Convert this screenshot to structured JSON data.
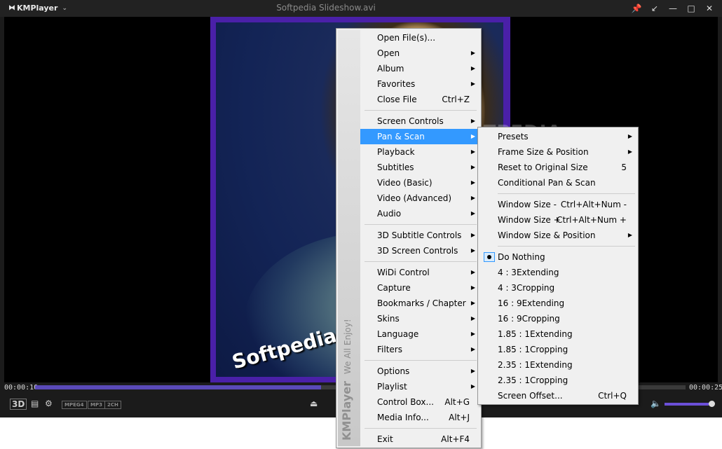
{
  "window": {
    "app_name": "KMPlayer",
    "title": "Softpedia Slideshow.avi",
    "buttons": [
      "pin",
      "back",
      "minimize",
      "maximize",
      "close"
    ]
  },
  "video": {
    "overlay_text": "Softpedia test",
    "watermark": "SOFTPEDIA"
  },
  "seek": {
    "current_time": "00:00:10",
    "total_time": "00:00:25",
    "progress": 0.44
  },
  "controls": {
    "badges": [
      "MPEG4",
      "MP3",
      "2CH"
    ],
    "volume": 0.9
  },
  "menu": {
    "brand": "KMPlayer",
    "tagline": "We All Enjoy!",
    "items": [
      {
        "label": "Open File(s)...",
        "shortcut": "",
        "sub": false
      },
      {
        "label": "Open",
        "shortcut": "",
        "sub": true
      },
      {
        "label": "Album",
        "shortcut": "",
        "sub": true
      },
      {
        "label": "Favorites",
        "shortcut": "",
        "sub": true
      },
      {
        "label": "Close File",
        "shortcut": "Ctrl+Z",
        "sub": false
      },
      {
        "label": "Screen Controls",
        "shortcut": "",
        "sub": true
      },
      {
        "label": "Pan & Scan",
        "shortcut": "",
        "sub": true
      },
      {
        "label": "Playback",
        "shortcut": "",
        "sub": true
      },
      {
        "label": "Subtitles",
        "shortcut": "",
        "sub": true
      },
      {
        "label": "Video (Basic)",
        "shortcut": "",
        "sub": true
      },
      {
        "label": "Video (Advanced)",
        "shortcut": "",
        "sub": true
      },
      {
        "label": "Audio",
        "shortcut": "",
        "sub": true
      },
      {
        "label": "3D Subtitle Controls",
        "shortcut": "",
        "sub": true
      },
      {
        "label": "3D Screen Controls",
        "shortcut": "",
        "sub": true
      },
      {
        "label": "WiDi Control",
        "shortcut": "",
        "sub": true
      },
      {
        "label": "Capture",
        "shortcut": "",
        "sub": true
      },
      {
        "label": "Bookmarks / Chapter",
        "shortcut": "",
        "sub": true
      },
      {
        "label": "Skins",
        "shortcut": "",
        "sub": true
      },
      {
        "label": "Language",
        "shortcut": "",
        "sub": true
      },
      {
        "label": "Filters",
        "shortcut": "",
        "sub": true
      },
      {
        "label": "Options",
        "shortcut": "",
        "sub": true
      },
      {
        "label": "Playlist",
        "shortcut": "",
        "sub": true
      },
      {
        "label": "Control Box...",
        "shortcut": "Alt+G",
        "sub": false
      },
      {
        "label": "Media Info...",
        "shortcut": "Alt+J",
        "sub": false
      },
      {
        "label": "Exit",
        "shortcut": "Alt+F4",
        "sub": false
      }
    ]
  },
  "submenu": {
    "items": [
      {
        "label": "Presets",
        "shortcut": "",
        "sub": true
      },
      {
        "label": "Frame Size & Position",
        "shortcut": "",
        "sub": true
      },
      {
        "label": "Reset to Original Size",
        "shortcut": "5",
        "sub": false
      },
      {
        "label": "Conditional Pan & Scan",
        "shortcut": "",
        "sub": false
      },
      {
        "label": "Window Size -",
        "shortcut": "Ctrl+Alt+Num -",
        "sub": false
      },
      {
        "label": "Window Size +",
        "shortcut": "Ctrl+Alt+Num +",
        "sub": false
      },
      {
        "label": "Window Size & Position",
        "shortcut": "",
        "sub": true
      },
      {
        "label": "Do Nothing",
        "shortcut": "",
        "sub": false
      },
      {
        "label": "4 : 3Extending",
        "shortcut": "",
        "sub": false
      },
      {
        "label": "4 : 3Cropping",
        "shortcut": "",
        "sub": false
      },
      {
        "label": "16 : 9Extending",
        "shortcut": "",
        "sub": false
      },
      {
        "label": "16 : 9Cropping",
        "shortcut": "",
        "sub": false
      },
      {
        "label": "1.85 : 1Extending",
        "shortcut": "",
        "sub": false
      },
      {
        "label": "1.85 : 1Cropping",
        "shortcut": "",
        "sub": false
      },
      {
        "label": "2.35 : 1Extending",
        "shortcut": "",
        "sub": false
      },
      {
        "label": "2.35 : 1Cropping",
        "shortcut": "",
        "sub": false
      },
      {
        "label": "Screen Offset...",
        "shortcut": "Ctrl+Q",
        "sub": false
      }
    ]
  }
}
